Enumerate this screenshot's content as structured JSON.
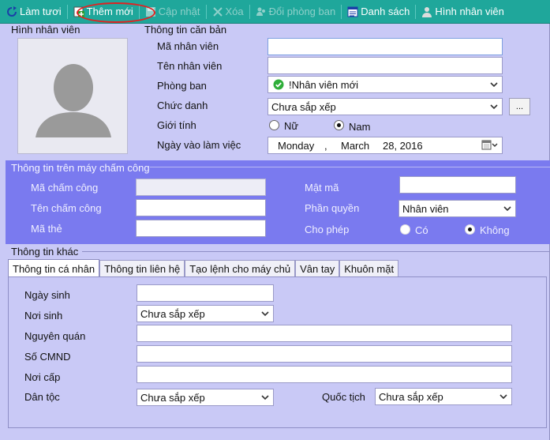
{
  "toolbar": {
    "refresh": "Làm tươi",
    "add_new": "Thêm mới",
    "update": "Cập nhật",
    "delete": "Xóa",
    "change_dept": "Đổi phòng ban",
    "list": "Danh sách",
    "photo": "Hình nhân viên"
  },
  "photo_section": {
    "title": "Hình nhân viên"
  },
  "basic": {
    "title": "Thông tin căn bản",
    "emp_code_label": "Mã nhân viên",
    "emp_code_value": "",
    "emp_name_label": "Tên nhân viên",
    "emp_name_value": "",
    "dept_label": "Phòng ban",
    "dept_value": "!Nhân viên mới",
    "position_label": "Chức danh",
    "position_value": "Chưa sắp xếp",
    "ellipsis": "...",
    "gender_label": "Giới tính",
    "gender_female": "Nữ",
    "gender_male": "Nam",
    "start_label": "Ngày vào làm việc",
    "date_weekday": "Monday",
    "date_sep": ",",
    "date_month": "March",
    "date_day_year": "28, 2016"
  },
  "mcc": {
    "title": "Thông tin trên máy chấm công",
    "code_label": "Mã chấm công",
    "name_label": "Tên chấm công",
    "card_label": "Mã thẻ",
    "password_label": "Mật mã",
    "role_label": "Phần quyền",
    "role_value": "Nhân viên",
    "allow_label": "Cho phép",
    "allow_yes": "Có",
    "allow_no": "Không"
  },
  "other": {
    "title": "Thông tin khác",
    "tabs": [
      "Thông tin cá nhân",
      "Thông tin liên hệ",
      "Tạo lệnh cho máy chủ",
      "Vân tay",
      "Khuôn mặt"
    ],
    "dob_label": "Ngày sinh",
    "birthplace_label": "Nơi sinh",
    "birthplace_value": "Chưa sắp xếp",
    "hometown_label": "Nguyên quán",
    "id_label": "Số CMND",
    "issue_place_label": "Nơi cấp",
    "ethnic_label": "Dân tộc",
    "ethnic_value": "Chưa sắp xếp",
    "nationality_label": "Quốc tịch",
    "nationality_value": "Chưa sắp xếp"
  },
  "colors": {
    "toolbar": "#1fa79b",
    "panel": "#c9c9f6",
    "mcc_panel": "#7a7aef",
    "highlight": "#e02222"
  }
}
